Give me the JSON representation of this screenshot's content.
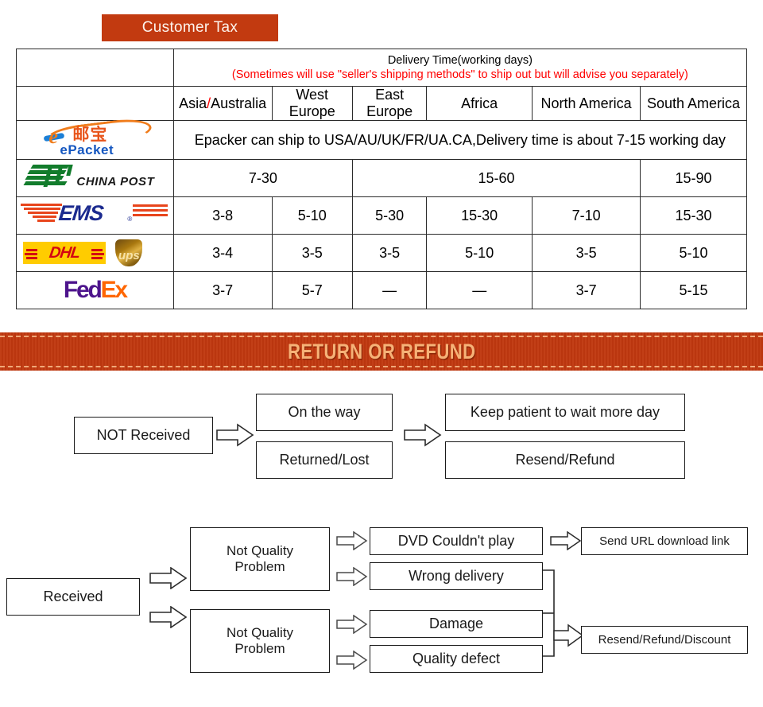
{
  "badge": {
    "label": "Customer Tax",
    "color": "#c23a10"
  },
  "shipping_table": {
    "header_note_line1": "Delivery Time(working days)",
    "header_note_line2": "(Sometimes will use \"seller's shipping methods\" to ship out but will advise you separately)",
    "header_note_line2_color": "#ff0000",
    "region_columns": [
      "Asia/Australia",
      "West Europe",
      "East Europe",
      "Africa",
      "North America",
      "South America"
    ],
    "asia_australia_parts": {
      "first": "Asia",
      "slash": "/",
      "second": "Australia"
    },
    "rows": [
      {
        "carrier": "ePacket",
        "logo": "epacket-logo",
        "note": "Epacker can ship to USA/AU/UK/FR/UA.CA,Delivery time is about 7-15 working day",
        "spans_all": true
      },
      {
        "carrier": "China Post",
        "logo": "china-post-logo",
        "grouped_values": [
          {
            "value": "7-30",
            "colspan": 2
          },
          {
            "value": "15-60",
            "colspan": 3
          },
          {
            "value": "15-90",
            "colspan": 1
          }
        ]
      },
      {
        "carrier": "EMS",
        "logo": "ems-logo",
        "values": [
          "3-8",
          "5-10",
          "5-30",
          "15-30",
          "7-10",
          "15-30"
        ]
      },
      {
        "carrier": "DHL / UPS",
        "logo": "dhl-ups-logo",
        "values": [
          "3-4",
          "3-5",
          "3-5",
          "5-10",
          "3-5",
          "5-10"
        ]
      },
      {
        "carrier": "FedEx",
        "logo": "fedex-logo",
        "values": [
          "3-7",
          "5-7",
          "—",
          "—",
          "3-7",
          "5-15"
        ]
      }
    ],
    "logo_text": {
      "epacket_e": "e",
      "epacket_cn": "邮宝",
      "epacket_word": "ePacket",
      "china_post_word": "CHINA POST",
      "ems_word": "EMS",
      "ems_reg": "®",
      "dhl_word": "DHL",
      "ups_word": "ups",
      "fedex_fed": "Fed",
      "fedex_ex": "Ex"
    }
  },
  "return_banner": {
    "title": "RETURN OR REFUND",
    "bg": "#c0380f",
    "text_color": "#f6b277"
  },
  "flow_not_received": {
    "start": "NOT Received",
    "middle": [
      "On the way",
      "Returned/Lost"
    ],
    "end": [
      "Keep patient to wait more day",
      "Resend/Refund"
    ]
  },
  "flow_received": {
    "start": "Received",
    "branches": [
      "Not Quality Problem",
      "Not Quality Problem"
    ],
    "branch_lines": [
      {
        "l1": "Not Quality",
        "l2": "Problem"
      },
      {
        "l1": "Not Quality",
        "l2": "Problem"
      }
    ],
    "issues": [
      "DVD Couldn't play",
      "Wrong delivery",
      "Damage",
      "Quality defect"
    ],
    "outcomes": [
      "Send URL download link",
      "Resend/Refund/Discount"
    ]
  }
}
